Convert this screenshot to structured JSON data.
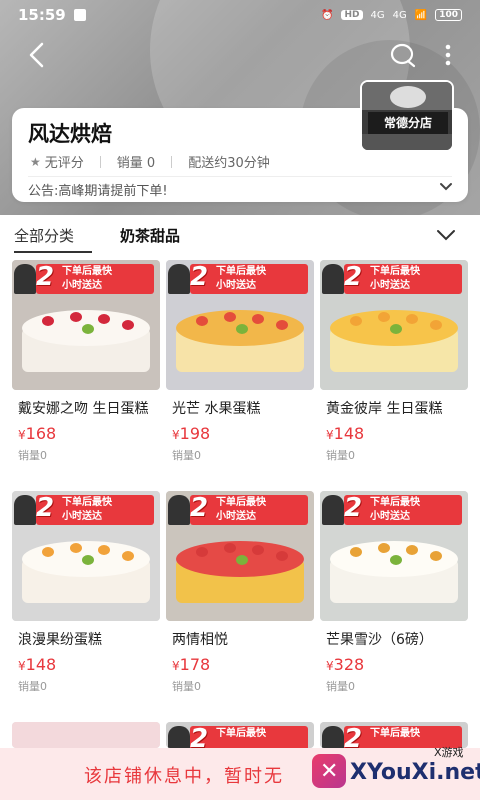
{
  "status_bar": {
    "time": "15:59",
    "hd_label": "HD",
    "signal1": "4G",
    "signal2": "4G",
    "battery": "100"
  },
  "store": {
    "name": "风达烘焙",
    "rating": "无评分",
    "sales": "销量 0",
    "delivery": "配送约30分钟",
    "notice": "公告:高峰期请提前下单!",
    "storefront_sign": "常德分店"
  },
  "tabs": {
    "all": "全部分类",
    "category": "奶茶甜品"
  },
  "promo": {
    "number": "2",
    "line1": "下单后最快",
    "line2": "小时送达"
  },
  "products": [
    {
      "name": "戴安娜之吻 生日蛋糕",
      "yen": "¥",
      "price": "168",
      "sold": "销量0"
    },
    {
      "name": "光芒 水果蛋糕",
      "yen": "¥",
      "price": "198",
      "sold": "销量0"
    },
    {
      "name": "黄金彼岸 生日蛋糕",
      "yen": "¥",
      "price": "148",
      "sold": "销量0"
    },
    {
      "name": "浪漫果纷蛋糕",
      "yen": "¥",
      "price": "148",
      "sold": "销量0"
    },
    {
      "name": "两情相悦",
      "yen": "¥",
      "price": "178",
      "sold": "销量0"
    },
    {
      "name": "芒果雪沙（6磅）",
      "yen": "¥",
      "price": "328",
      "sold": "销量0"
    }
  ],
  "closed_notice": "该店铺休息中，暂时无",
  "watermark": {
    "small": "X游戏",
    "big": "XYouXi.net"
  },
  "colors": {
    "accent": "#e8383d",
    "closed_bg": "#fde9ea"
  }
}
